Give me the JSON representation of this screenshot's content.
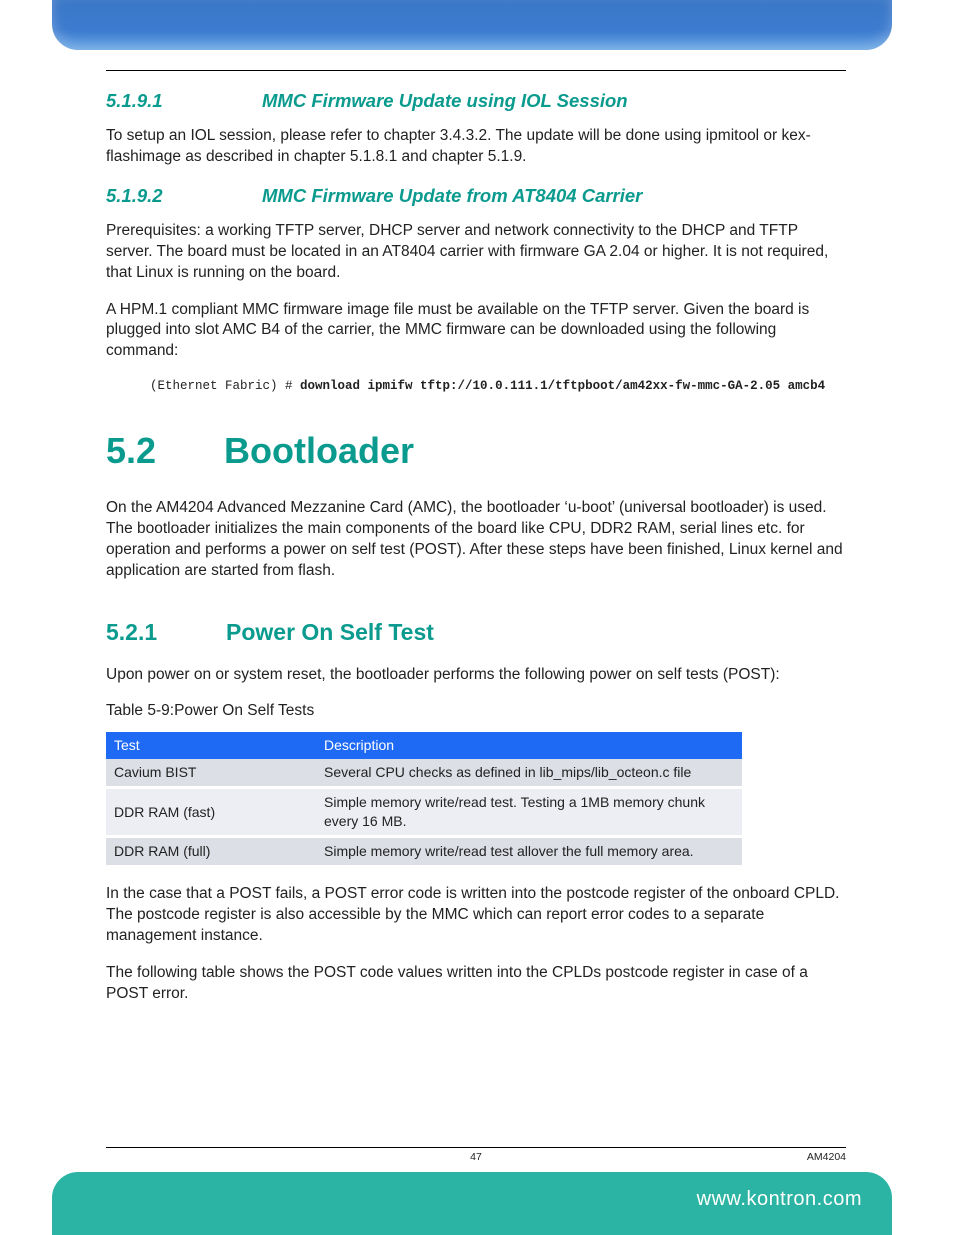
{
  "section_5191": {
    "num": "5.1.9.1",
    "title": "MMC Firmware Update using IOL Session",
    "p1": "To setup an IOL session, please refer to chapter 3.4.3.2. The update will be done using ipmitool or kex-flashimage as described in chapter 5.1.8.1 and chapter 5.1.9."
  },
  "section_5192": {
    "num": "5.1.9.2",
    "title": "MMC Firmware Update from AT8404 Carrier",
    "p1": "Prerequisites: a working TFTP server, DHCP server and network connectivity to the DHCP and TFTP server. The board must be located in an AT8404 carrier with firmware GA 2.04 or higher. It is not required, that Linux is running on the board.",
    "p2": "A HPM.1 compliant MMC firmware image file must be available on the TFTP server. Given the board is plugged into slot AMC B4 of the carrier, the MMC firmware can be downloaded using the following command:",
    "code_prompt": "(Ethernet Fabric) # ",
    "code_cmd": "download ipmifw tftp://10.0.111.1/tftpboot/am42xx-fw-mmc-GA-2.05 amcb4"
  },
  "section_52": {
    "num": "5.2",
    "title": "Bootloader",
    "p1": "On the AM4204 Advanced Mezzanine Card (AMC), the bootloader ‘u-boot’ (universal bootloader) is used. The bootloader initializes the main components of the board like CPU, DDR2 RAM, serial lines etc. for operation and performs a power on self test (POST). After these steps have been finished, Linux kernel and application are started from flash."
  },
  "section_521": {
    "num": "5.2.1",
    "title": "Power On Self Test",
    "p1": "Upon power on or system reset, the bootloader performs the following power on self tests (POST):",
    "table_caption": "Table 5-9:Power On Self Tests",
    "th1": "Test",
    "th2": "Description",
    "rows": [
      {
        "c1": "Cavium BIST",
        "c2": "Several CPU checks as defined in lib_mips/lib_octeon.c file"
      },
      {
        "c1": "DDR RAM (fast)",
        "c2": "Simple memory write/read test. Testing a 1MB memory chunk every 16 MB."
      },
      {
        "c1": "DDR RAM (full)",
        "c2": "Simple memory write/read test allover the full memory area."
      }
    ],
    "p2": "In the case that a POST fails, a POST error code is written into the postcode register of the onboard CPLD. The postcode register is also accessible by the MMC which can report error codes to a separate management instance.",
    "p3": "The following table shows the POST code values written into the CPLDs postcode register in case of a POST error."
  },
  "footer": {
    "page": "47",
    "doc": "AM4204",
    "url": "www.kontron.com"
  }
}
